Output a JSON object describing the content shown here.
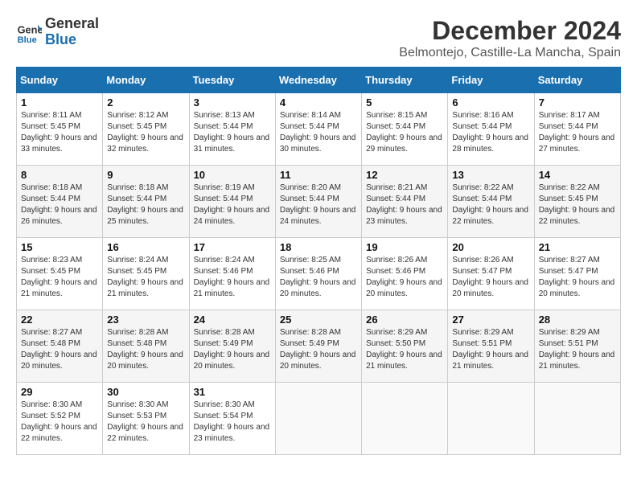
{
  "header": {
    "logo_line1": "General",
    "logo_line2": "Blue",
    "month_title": "December 2024",
    "location": "Belmontejo, Castille-La Mancha, Spain"
  },
  "weekdays": [
    "Sunday",
    "Monday",
    "Tuesday",
    "Wednesday",
    "Thursday",
    "Friday",
    "Saturday"
  ],
  "weeks": [
    [
      {
        "day": 1,
        "sunrise": "8:11 AM",
        "sunset": "5:45 PM",
        "daylight": "9 hours and 33 minutes."
      },
      {
        "day": 2,
        "sunrise": "8:12 AM",
        "sunset": "5:45 PM",
        "daylight": "9 hours and 32 minutes."
      },
      {
        "day": 3,
        "sunrise": "8:13 AM",
        "sunset": "5:44 PM",
        "daylight": "9 hours and 31 minutes."
      },
      {
        "day": 4,
        "sunrise": "8:14 AM",
        "sunset": "5:44 PM",
        "daylight": "9 hours and 30 minutes."
      },
      {
        "day": 5,
        "sunrise": "8:15 AM",
        "sunset": "5:44 PM",
        "daylight": "9 hours and 29 minutes."
      },
      {
        "day": 6,
        "sunrise": "8:16 AM",
        "sunset": "5:44 PM",
        "daylight": "9 hours and 28 minutes."
      },
      {
        "day": 7,
        "sunrise": "8:17 AM",
        "sunset": "5:44 PM",
        "daylight": "9 hours and 27 minutes."
      }
    ],
    [
      {
        "day": 8,
        "sunrise": "8:18 AM",
        "sunset": "5:44 PM",
        "daylight": "9 hours and 26 minutes."
      },
      {
        "day": 9,
        "sunrise": "8:18 AM",
        "sunset": "5:44 PM",
        "daylight": "9 hours and 25 minutes."
      },
      {
        "day": 10,
        "sunrise": "8:19 AM",
        "sunset": "5:44 PM",
        "daylight": "9 hours and 24 minutes."
      },
      {
        "day": 11,
        "sunrise": "8:20 AM",
        "sunset": "5:44 PM",
        "daylight": "9 hours and 24 minutes."
      },
      {
        "day": 12,
        "sunrise": "8:21 AM",
        "sunset": "5:44 PM",
        "daylight": "9 hours and 23 minutes."
      },
      {
        "day": 13,
        "sunrise": "8:22 AM",
        "sunset": "5:44 PM",
        "daylight": "9 hours and 22 minutes."
      },
      {
        "day": 14,
        "sunrise": "8:22 AM",
        "sunset": "5:45 PM",
        "daylight": "9 hours and 22 minutes."
      }
    ],
    [
      {
        "day": 15,
        "sunrise": "8:23 AM",
        "sunset": "5:45 PM",
        "daylight": "9 hours and 21 minutes."
      },
      {
        "day": 16,
        "sunrise": "8:24 AM",
        "sunset": "5:45 PM",
        "daylight": "9 hours and 21 minutes."
      },
      {
        "day": 17,
        "sunrise": "8:24 AM",
        "sunset": "5:46 PM",
        "daylight": "9 hours and 21 minutes."
      },
      {
        "day": 18,
        "sunrise": "8:25 AM",
        "sunset": "5:46 PM",
        "daylight": "9 hours and 20 minutes."
      },
      {
        "day": 19,
        "sunrise": "8:26 AM",
        "sunset": "5:46 PM",
        "daylight": "9 hours and 20 minutes."
      },
      {
        "day": 20,
        "sunrise": "8:26 AM",
        "sunset": "5:47 PM",
        "daylight": "9 hours and 20 minutes."
      },
      {
        "day": 21,
        "sunrise": "8:27 AM",
        "sunset": "5:47 PM",
        "daylight": "9 hours and 20 minutes."
      }
    ],
    [
      {
        "day": 22,
        "sunrise": "8:27 AM",
        "sunset": "5:48 PM",
        "daylight": "9 hours and 20 minutes."
      },
      {
        "day": 23,
        "sunrise": "8:28 AM",
        "sunset": "5:48 PM",
        "daylight": "9 hours and 20 minutes."
      },
      {
        "day": 24,
        "sunrise": "8:28 AM",
        "sunset": "5:49 PM",
        "daylight": "9 hours and 20 minutes."
      },
      {
        "day": 25,
        "sunrise": "8:28 AM",
        "sunset": "5:49 PM",
        "daylight": "9 hours and 20 minutes."
      },
      {
        "day": 26,
        "sunrise": "8:29 AM",
        "sunset": "5:50 PM",
        "daylight": "9 hours and 21 minutes."
      },
      {
        "day": 27,
        "sunrise": "8:29 AM",
        "sunset": "5:51 PM",
        "daylight": "9 hours and 21 minutes."
      },
      {
        "day": 28,
        "sunrise": "8:29 AM",
        "sunset": "5:51 PM",
        "daylight": "9 hours and 21 minutes."
      }
    ],
    [
      {
        "day": 29,
        "sunrise": "8:30 AM",
        "sunset": "5:52 PM",
        "daylight": "9 hours and 22 minutes."
      },
      {
        "day": 30,
        "sunrise": "8:30 AM",
        "sunset": "5:53 PM",
        "daylight": "9 hours and 22 minutes."
      },
      {
        "day": 31,
        "sunrise": "8:30 AM",
        "sunset": "5:54 PM",
        "daylight": "9 hours and 23 minutes."
      },
      null,
      null,
      null,
      null
    ]
  ]
}
